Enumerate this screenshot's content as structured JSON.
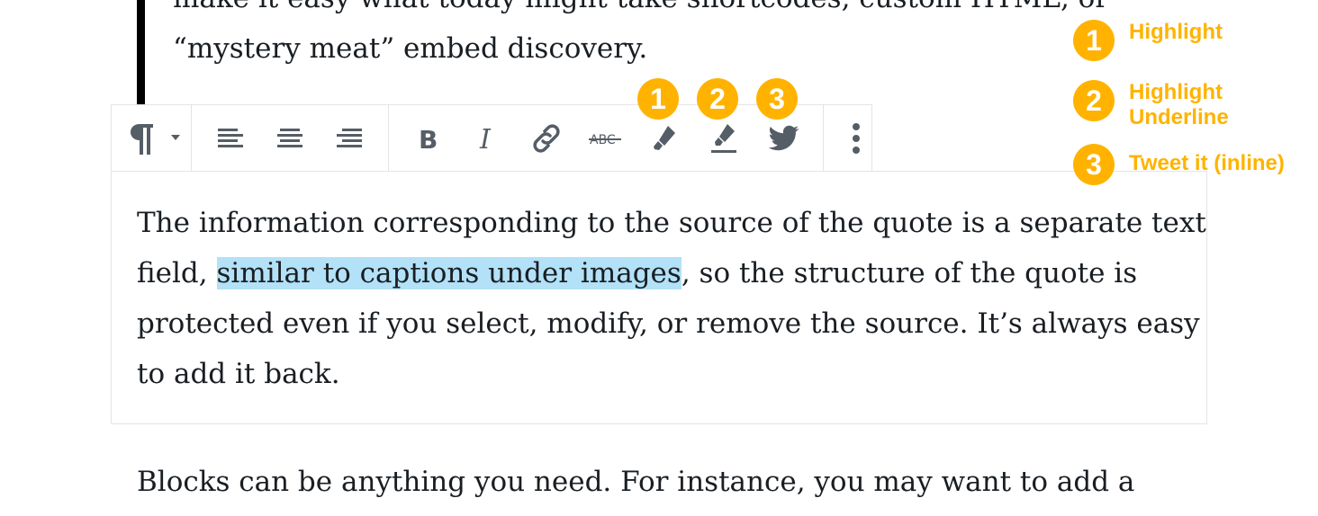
{
  "quote": {
    "lines": [
      "make it easy what today might take shortcodes, custom HTML, or",
      "“mystery meat” embed discovery."
    ]
  },
  "toolbar": {
    "paragraph_icon": "paragraph-icon",
    "buttons": [
      {
        "name": "align-left",
        "icon": "align-left-icon"
      },
      {
        "name": "align-center",
        "icon": "align-center-icon"
      },
      {
        "name": "align-right",
        "icon": "align-right-icon"
      },
      {
        "name": "bold",
        "icon": "bold-icon",
        "label": "B"
      },
      {
        "name": "italic",
        "icon": "italic-icon",
        "label": "I"
      },
      {
        "name": "link",
        "icon": "link-icon"
      },
      {
        "name": "strikethrough",
        "icon": "strikethrough-icon",
        "label": "ABC"
      },
      {
        "name": "highlight",
        "icon": "marker-icon"
      },
      {
        "name": "highlight-underline",
        "icon": "marker-underline-icon"
      },
      {
        "name": "tweet-it",
        "icon": "twitter-icon"
      },
      {
        "name": "more-options",
        "icon": "more-vertical-icon"
      }
    ],
    "badges": [
      "1",
      "2",
      "3"
    ]
  },
  "editor": {
    "line1": "The information corresponding to the source of the quote is a separate text",
    "line2_before": "field, ",
    "line2_highlight": "similar to captions under images",
    "line2_after": ", so the structure of the quote is",
    "line3": "protected even if you select, modify, or remove the source. It’s always easy",
    "line4": "to add it back."
  },
  "next_paragraph": "Blocks can be anything you need. For instance, you may want to add a",
  "legend": [
    {
      "number": "1",
      "lines": [
        "Highlight"
      ]
    },
    {
      "number": "2",
      "lines": [
        "Highlight",
        "Underline"
      ]
    },
    {
      "number": "3",
      "lines": [
        "Tweet it (inline)"
      ]
    }
  ],
  "colors": {
    "accent": "#ffb300",
    "highlight": "#b3e1f7",
    "icon": "#555d66",
    "text": "#191e23"
  }
}
